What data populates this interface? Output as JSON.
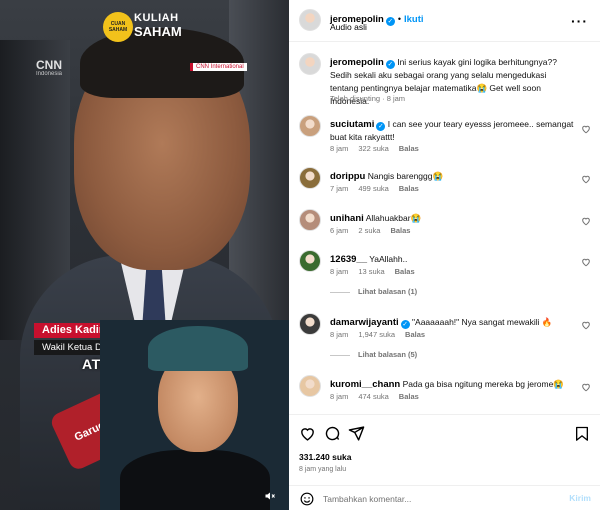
{
  "video": {
    "channel_logo_badge": "CUAN SAHAM",
    "channel_logo_line1": "KULIAH",
    "channel_logo_line2": "SAHAM",
    "network_logo": "CNN",
    "network_sub": "Indonesia",
    "network_intl": "CNN International",
    "lower_third_name": "Adies Kadir",
    "lower_third_role": "Wakil Ketua DPR",
    "caption": "ATAU KIT",
    "mic_label": "Garudo",
    "mute_icon": "speaker-muted-icon"
  },
  "post": {
    "username": "jeromepolin",
    "follow_label": "Ikuti",
    "audio_label": "Audio asli",
    "caption_username": "jeromepolin",
    "caption_text": "Ini serius kayak gini logika berhitungnya?? Sedih sekali aku sebagai orang yang selalu mengedukasi tentang pentingnya belajar matematika😭  Get well soon Indonesia.",
    "caption_meta": "Telah disunting · 8 jam"
  },
  "comments": [
    {
      "username": "suciutami",
      "verified": true,
      "text": "I can see your teary eyesss jeromeee.. semangat buat kita rakyattt!",
      "time": "8 jam",
      "likes": "322 suka",
      "reply_label": "Balas",
      "avatar_color": "#c9a07d",
      "view_replies": ""
    },
    {
      "username": "dorippu",
      "verified": false,
      "text": "Nangis barenggg😭",
      "time": "7 jam",
      "likes": "499 suka",
      "reply_label": "Balas",
      "avatar_color": "#8a6d3b",
      "view_replies": ""
    },
    {
      "username": "unihani",
      "verified": false,
      "text": "Allahuakbar😭",
      "time": "6 jam",
      "likes": "2 suka",
      "reply_label": "Balas",
      "avatar_color": "#b58d7a",
      "view_replies": ""
    },
    {
      "username": "12639__",
      "verified": false,
      "text": "YaAllahh..",
      "time": "8 jam",
      "likes": "13 suka",
      "reply_label": "Balas",
      "avatar_color": "#3a6b2f",
      "view_replies": "Lihat balasan (1)"
    },
    {
      "username": "damarwijayanti",
      "verified": true,
      "text": "\"Aaaaaaah!\" Nya sangat mewakili 🔥",
      "time": "8 jam",
      "likes": "1,947 suka",
      "reply_label": "Balas",
      "avatar_color": "#3b3b3b",
      "view_replies": "Lihat balasan (5)"
    },
    {
      "username": "kuromi__chann",
      "verified": false,
      "text": "Pada ga bisa ngitung mereka bg jerome😭",
      "time": "8 jam",
      "likes": "474 suka",
      "reply_label": "Balas",
      "avatar_color": "#e7c7a3",
      "view_replies": ""
    }
  ],
  "footer": {
    "likes_count": "331.240 suka",
    "posted_ago": "8 jam yang lalu",
    "comment_placeholder": "Tambahkan komentar...",
    "send_label": "Kirim"
  },
  "colors": {
    "accent": "#0095f6",
    "muted": "#737373",
    "send_disabled": "#b2dffc",
    "news_red": "#c8102e",
    "logo_yellow": "#f2c21b"
  }
}
